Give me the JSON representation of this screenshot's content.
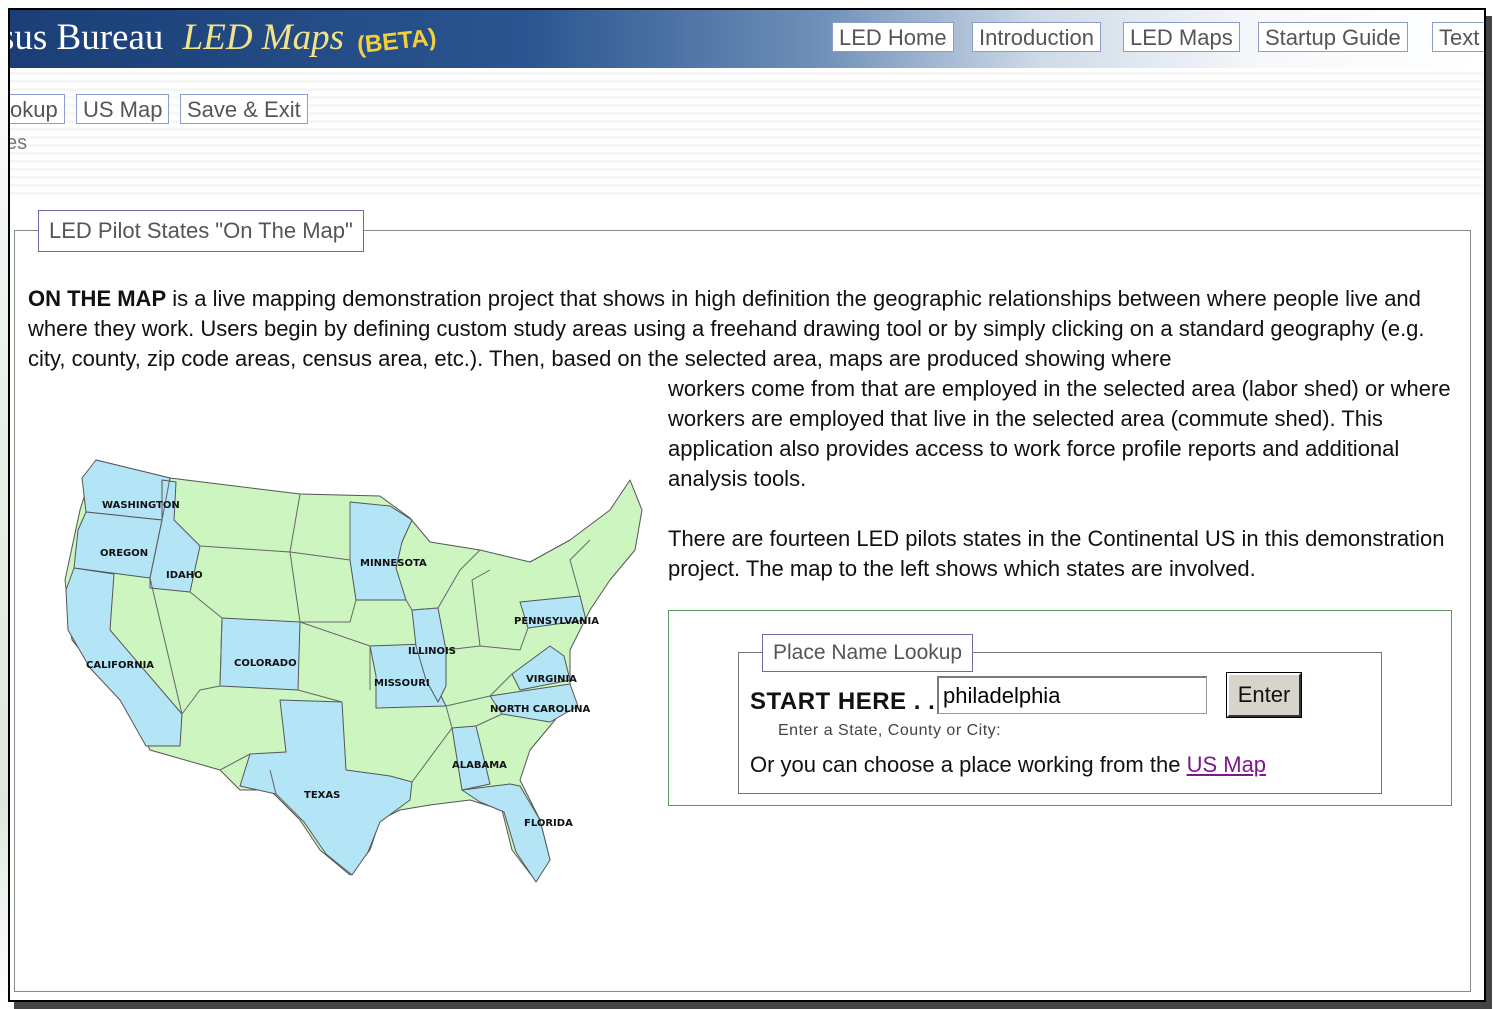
{
  "header": {
    "brand_text": "sus Bureau",
    "brand_product": "LED Maps",
    "brand_beta": "(BETA)",
    "nav": [
      "LED Home",
      "Introduction",
      "LED Maps",
      "Startup Guide",
      "Text"
    ]
  },
  "subnav": {
    "buttons": [
      "okup",
      "US Map",
      "Save & Exit"
    ],
    "cut_text": "es"
  },
  "panel": {
    "legend": "LED Pilot States \"On The Map\"",
    "intro_bold": "ON THE MAP",
    "intro_text": " is a live mapping demonstration project that shows in high definition the geographic relationships between where people live and where they work. Users begin by defining custom study areas using a freehand drawing tool or by simply clicking on a standard geography (e.g. city, county, zip code areas, census area, etc.). Then, based on the selected area, maps are produced showing where",
    "intro_right": "workers come from that are employed in the selected area (labor shed) or where workers are employed that live in the selected area (commute shed). This application also provides access to work force profile reports and additional analysis tools.",
    "pilots_text": "There are fourteen LED pilots states in the Continental US in this demonstration project. The map to the left shows which states are involved."
  },
  "map": {
    "pilot_color": "#b3e5f7",
    "other_color": "#ccf5c0",
    "labels": [
      "WASHINGTON",
      "OREGON",
      "IDAHO",
      "CALIFORNIA",
      "COLORADO",
      "MINNESOTA",
      "ILLINOIS",
      "MISSOURI",
      "TEXAS",
      "PENNSYLVANIA",
      "VIRGINIA",
      "NORTH CAROLINA",
      "ALABAMA",
      "FLORIDA"
    ]
  },
  "lookup": {
    "legend": "Place Name Lookup",
    "start_label": "START HERE . . .",
    "input_value": "philadelphia",
    "enter_label": "Enter",
    "hint": "Enter a State, County or City:",
    "choose_text": "Or you can choose a place working from the ",
    "choose_link": "US Map"
  }
}
